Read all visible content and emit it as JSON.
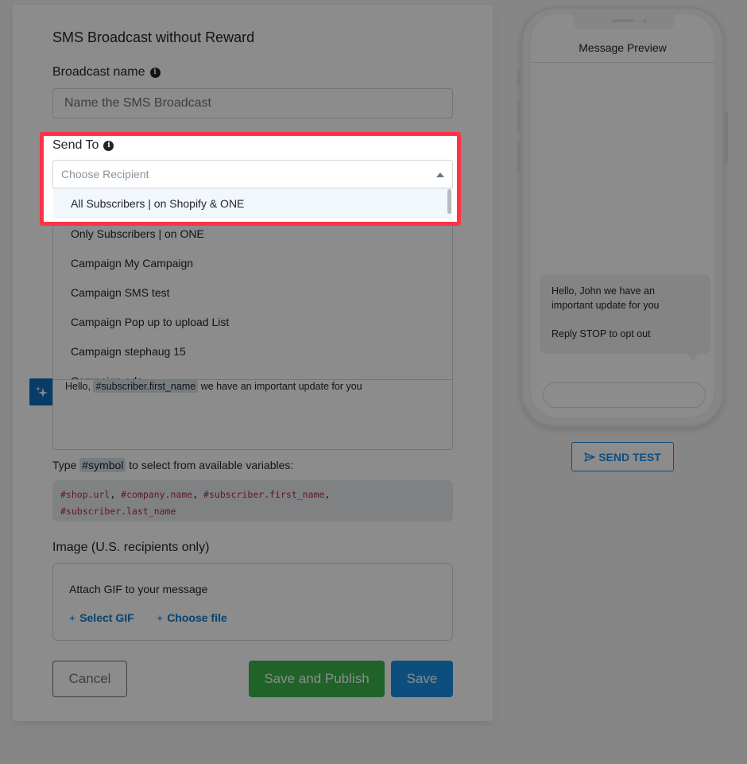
{
  "form": {
    "title": "SMS Broadcast without Reward",
    "broadcast_name_label": "Broadcast name",
    "broadcast_name_placeholder": "Name the SMS Broadcast",
    "send_to_label": "Send To",
    "send_to_placeholder": "Choose Recipient",
    "recipient_options": [
      "All Subscribers | on Shopify & ONE",
      "Only Subscribers | on ONE",
      "Campaign My Campaign",
      "Campaign SMS test",
      "Campaign Pop up to upload List",
      "Campaign stephaug 15",
      "Campaign ads"
    ],
    "message": {
      "prefix": "Hello,",
      "variable": "#subscriber.first_name",
      "suffix": "we have an important update for you"
    },
    "hint_prefix": "Type",
    "hint_chip": "#symbol",
    "hint_suffix": "to select from available variables:",
    "variables": [
      "#shop.url",
      "#company.name",
      "#subscriber.first_name",
      "#subscriber.last_name"
    ],
    "image_label": "Image (U.S. recipients only)",
    "attach_text": "Attach GIF to your message",
    "select_gif_label": "Select GIF",
    "choose_file_label": "Choose file",
    "cancel_label": "Cancel",
    "save_publish_label": "Save and Publish",
    "save_label": "Save"
  },
  "preview": {
    "title": "Message Preview",
    "bubble_line1": "Hello, John we have an important update for you",
    "bubble_line2": "Reply STOP to opt out",
    "send_test_label": "SEND TEST"
  },
  "colors": {
    "highlight": "#ff3347",
    "primary": "#1b8fe8",
    "success": "#39b54a",
    "overlay": "rgba(0,0,0,0.45)"
  }
}
